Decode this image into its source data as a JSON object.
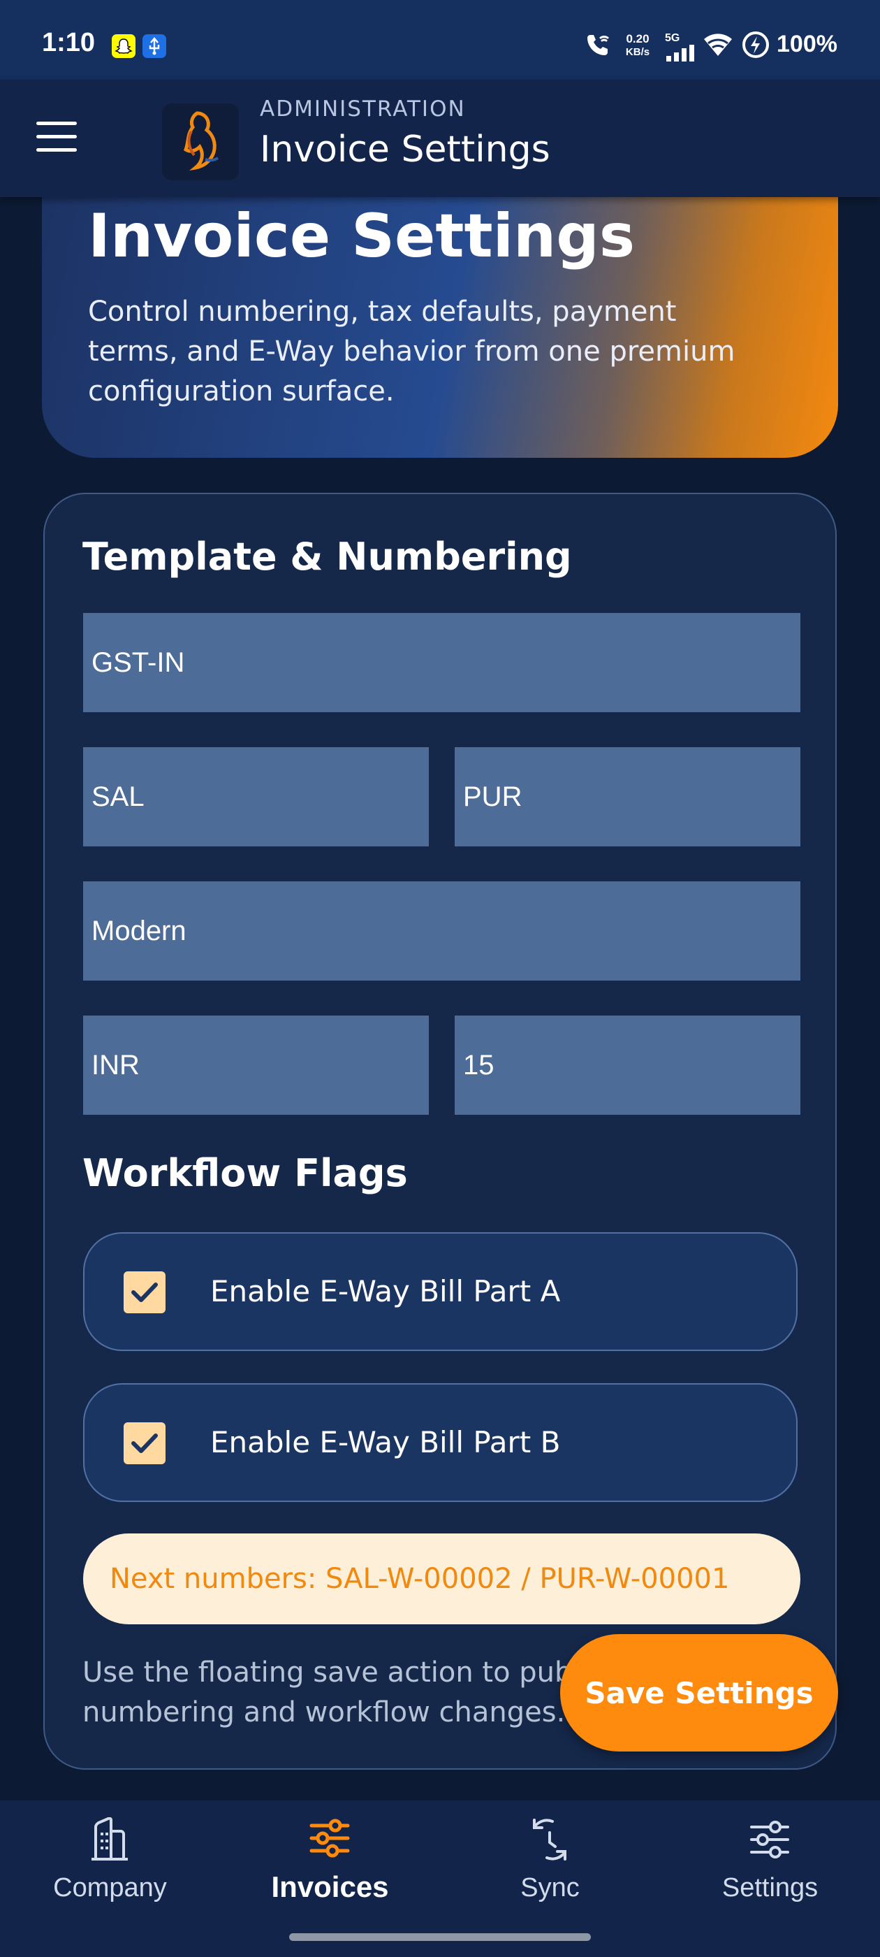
{
  "status_bar": {
    "time": "1:10",
    "speed_value": "0.20",
    "speed_unit": "KB/s",
    "network": "5G",
    "battery": "100%",
    "icons": [
      "snapchat-icon",
      "usb-icon",
      "wifi-call-icon",
      "signal-icon",
      "wifi-icon",
      "charging-icon"
    ]
  },
  "app_bar": {
    "subtitle": "ADMINISTRATION",
    "title": "Invoice Settings",
    "menu_icon": "hamburger-menu-icon",
    "logo_icon": "app-logo-icon"
  },
  "hero": {
    "title": "Invoice Settings",
    "description": "Control numbering, tax defaults, payment terms, and E-Way behavior from one premium configuration surface."
  },
  "template_section": {
    "title": "Template & Numbering",
    "fields": {
      "template_code": "GST-IN",
      "sales_prefix": "SAL",
      "purchase_prefix": "PUR",
      "style": "Modern",
      "currency": "INR",
      "payment_terms": "15"
    }
  },
  "workflow_section": {
    "title": "Workflow Flags",
    "flags": [
      {
        "label": "Enable E-Way Bill Part A",
        "checked": true
      },
      {
        "label": "Enable E-Way Bill Part B",
        "checked": true
      }
    ],
    "next_numbers": "Next numbers: SAL-W-00002 / PUR-W-00001",
    "hint": "Use the floating save action to publish numbering and workflow changes."
  },
  "fab": {
    "label": "Save Settings"
  },
  "bottom_nav": {
    "items": [
      {
        "label": "Company",
        "icon": "building-icon",
        "active": false
      },
      {
        "label": "Invoices",
        "icon": "sliders-icon",
        "active": true
      },
      {
        "label": "Sync",
        "icon": "sync-icon",
        "active": false
      },
      {
        "label": "Settings",
        "icon": "settings-sliders-icon",
        "active": false
      }
    ]
  },
  "colors": {
    "accent": "#ff8b0e",
    "background": "#0c1a33",
    "card": "#15284a",
    "field": "#4d6c97"
  }
}
